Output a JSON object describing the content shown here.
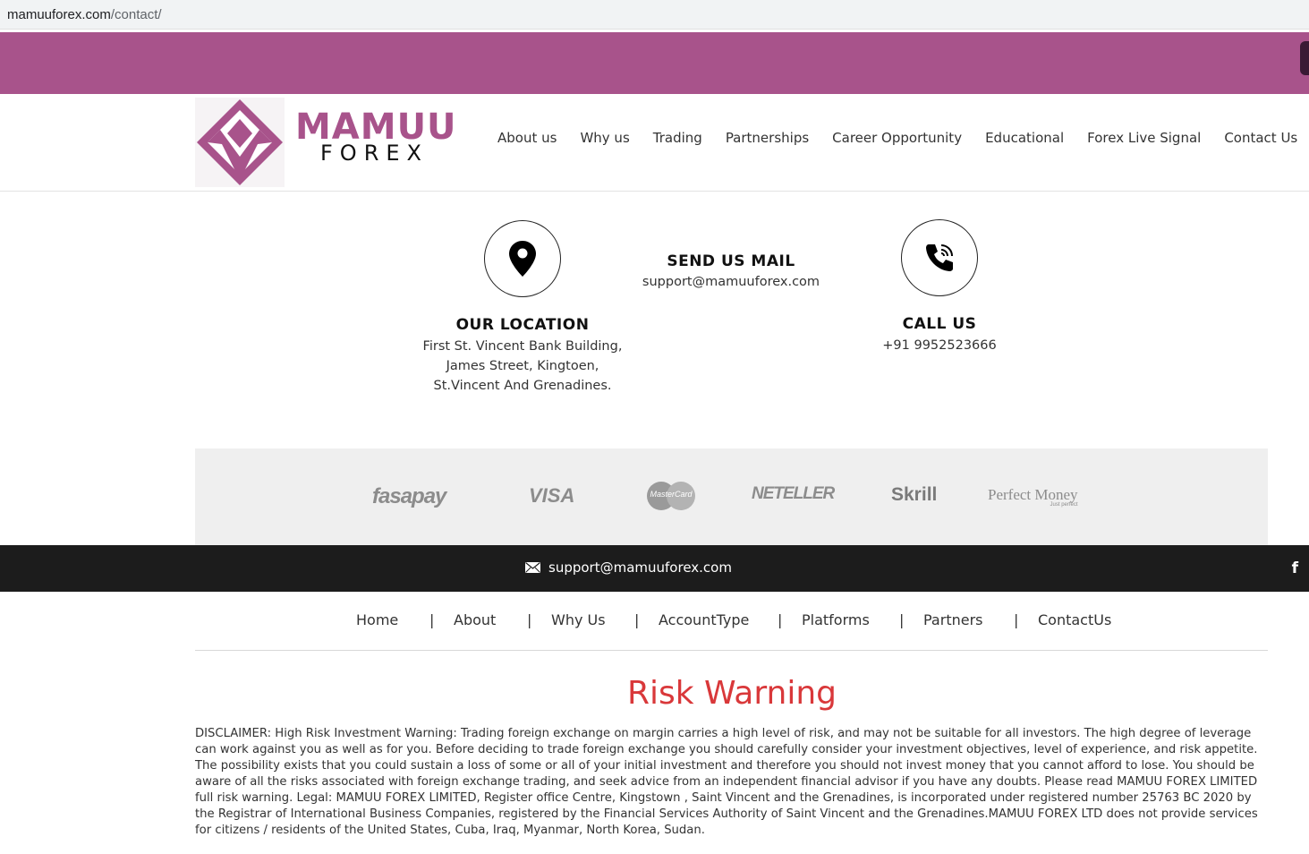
{
  "browser": {
    "url_host": "mamuuforex.com",
    "url_path": "/contact/"
  },
  "brand": {
    "name_top": "MAMUU",
    "name_bottom": "FOREX",
    "color": "#a8538b"
  },
  "nav": {
    "items": [
      "About us",
      "Why us",
      "Trading",
      "Partnerships",
      "Career Opportunity",
      "Educational",
      "Forex Live Signal",
      "Contact Us"
    ]
  },
  "contact": {
    "location": {
      "title": "OUR LOCATION",
      "line1": "First St. Vincent Bank Building,",
      "line2": "James Street, Kingtoen,",
      "line3": "St.Vincent And Grenadines.",
      "icon": "map-pin-icon"
    },
    "mail": {
      "title": "SEND US MAIL",
      "email": "support@mamuuforex.com"
    },
    "call": {
      "title": "CALL US",
      "phone": "+91 9952523666",
      "icon": "phone-icon"
    }
  },
  "payments": [
    "fasapay",
    "VISA",
    "MasterCard",
    "NETELLER",
    "Skrill",
    "Perfect Money"
  ],
  "payments_sub": {
    "perfect_money_tagline": "Just perfect"
  },
  "topbar": {
    "email": "support@mamuuforex.com",
    "facebook": "f"
  },
  "footer_nav": {
    "items": [
      "Home",
      "About",
      "Why Us",
      "AccountType",
      "Platforms",
      "Partners",
      "ContactUs"
    ],
    "separator": "|"
  },
  "risk": {
    "title": "Risk Warning",
    "title_color": "#d9383a",
    "text": "DISCLAIMER: High Risk Investment Warning: Trading foreign exchange on margin carries a high level of risk, and may not be suitable for all investors. The high degree of leverage can work against you as well as for you. Before deciding to trade foreign exchange you should carefully consider your investment objectives, level of experience, and risk appetite. The possibility exists that you could sustain a loss of some or all of your initial investment and therefore you should not invest money that you cannot afford to lose. You should be aware of all the risks associated with foreign exchange trading, and seek advice from an independent financial advisor if you have any doubts. Please read MAMUU FOREX LIMITED full risk warning. Legal: MAMUU FOREX LIMITED, Register office Centre, Kingstown , Saint Vincent and the Grenadines, is incorporated under registered number 25763 BC 2020 by the Registrar of International Business Companies, registered by the Financial Services Authority of Saint Vincent and the Grenadines.MAMUU FOREX LTD does not provide services for citizens / residents of the United States, Cuba, Iraq, Myanmar, North Korea, Sudan."
  }
}
